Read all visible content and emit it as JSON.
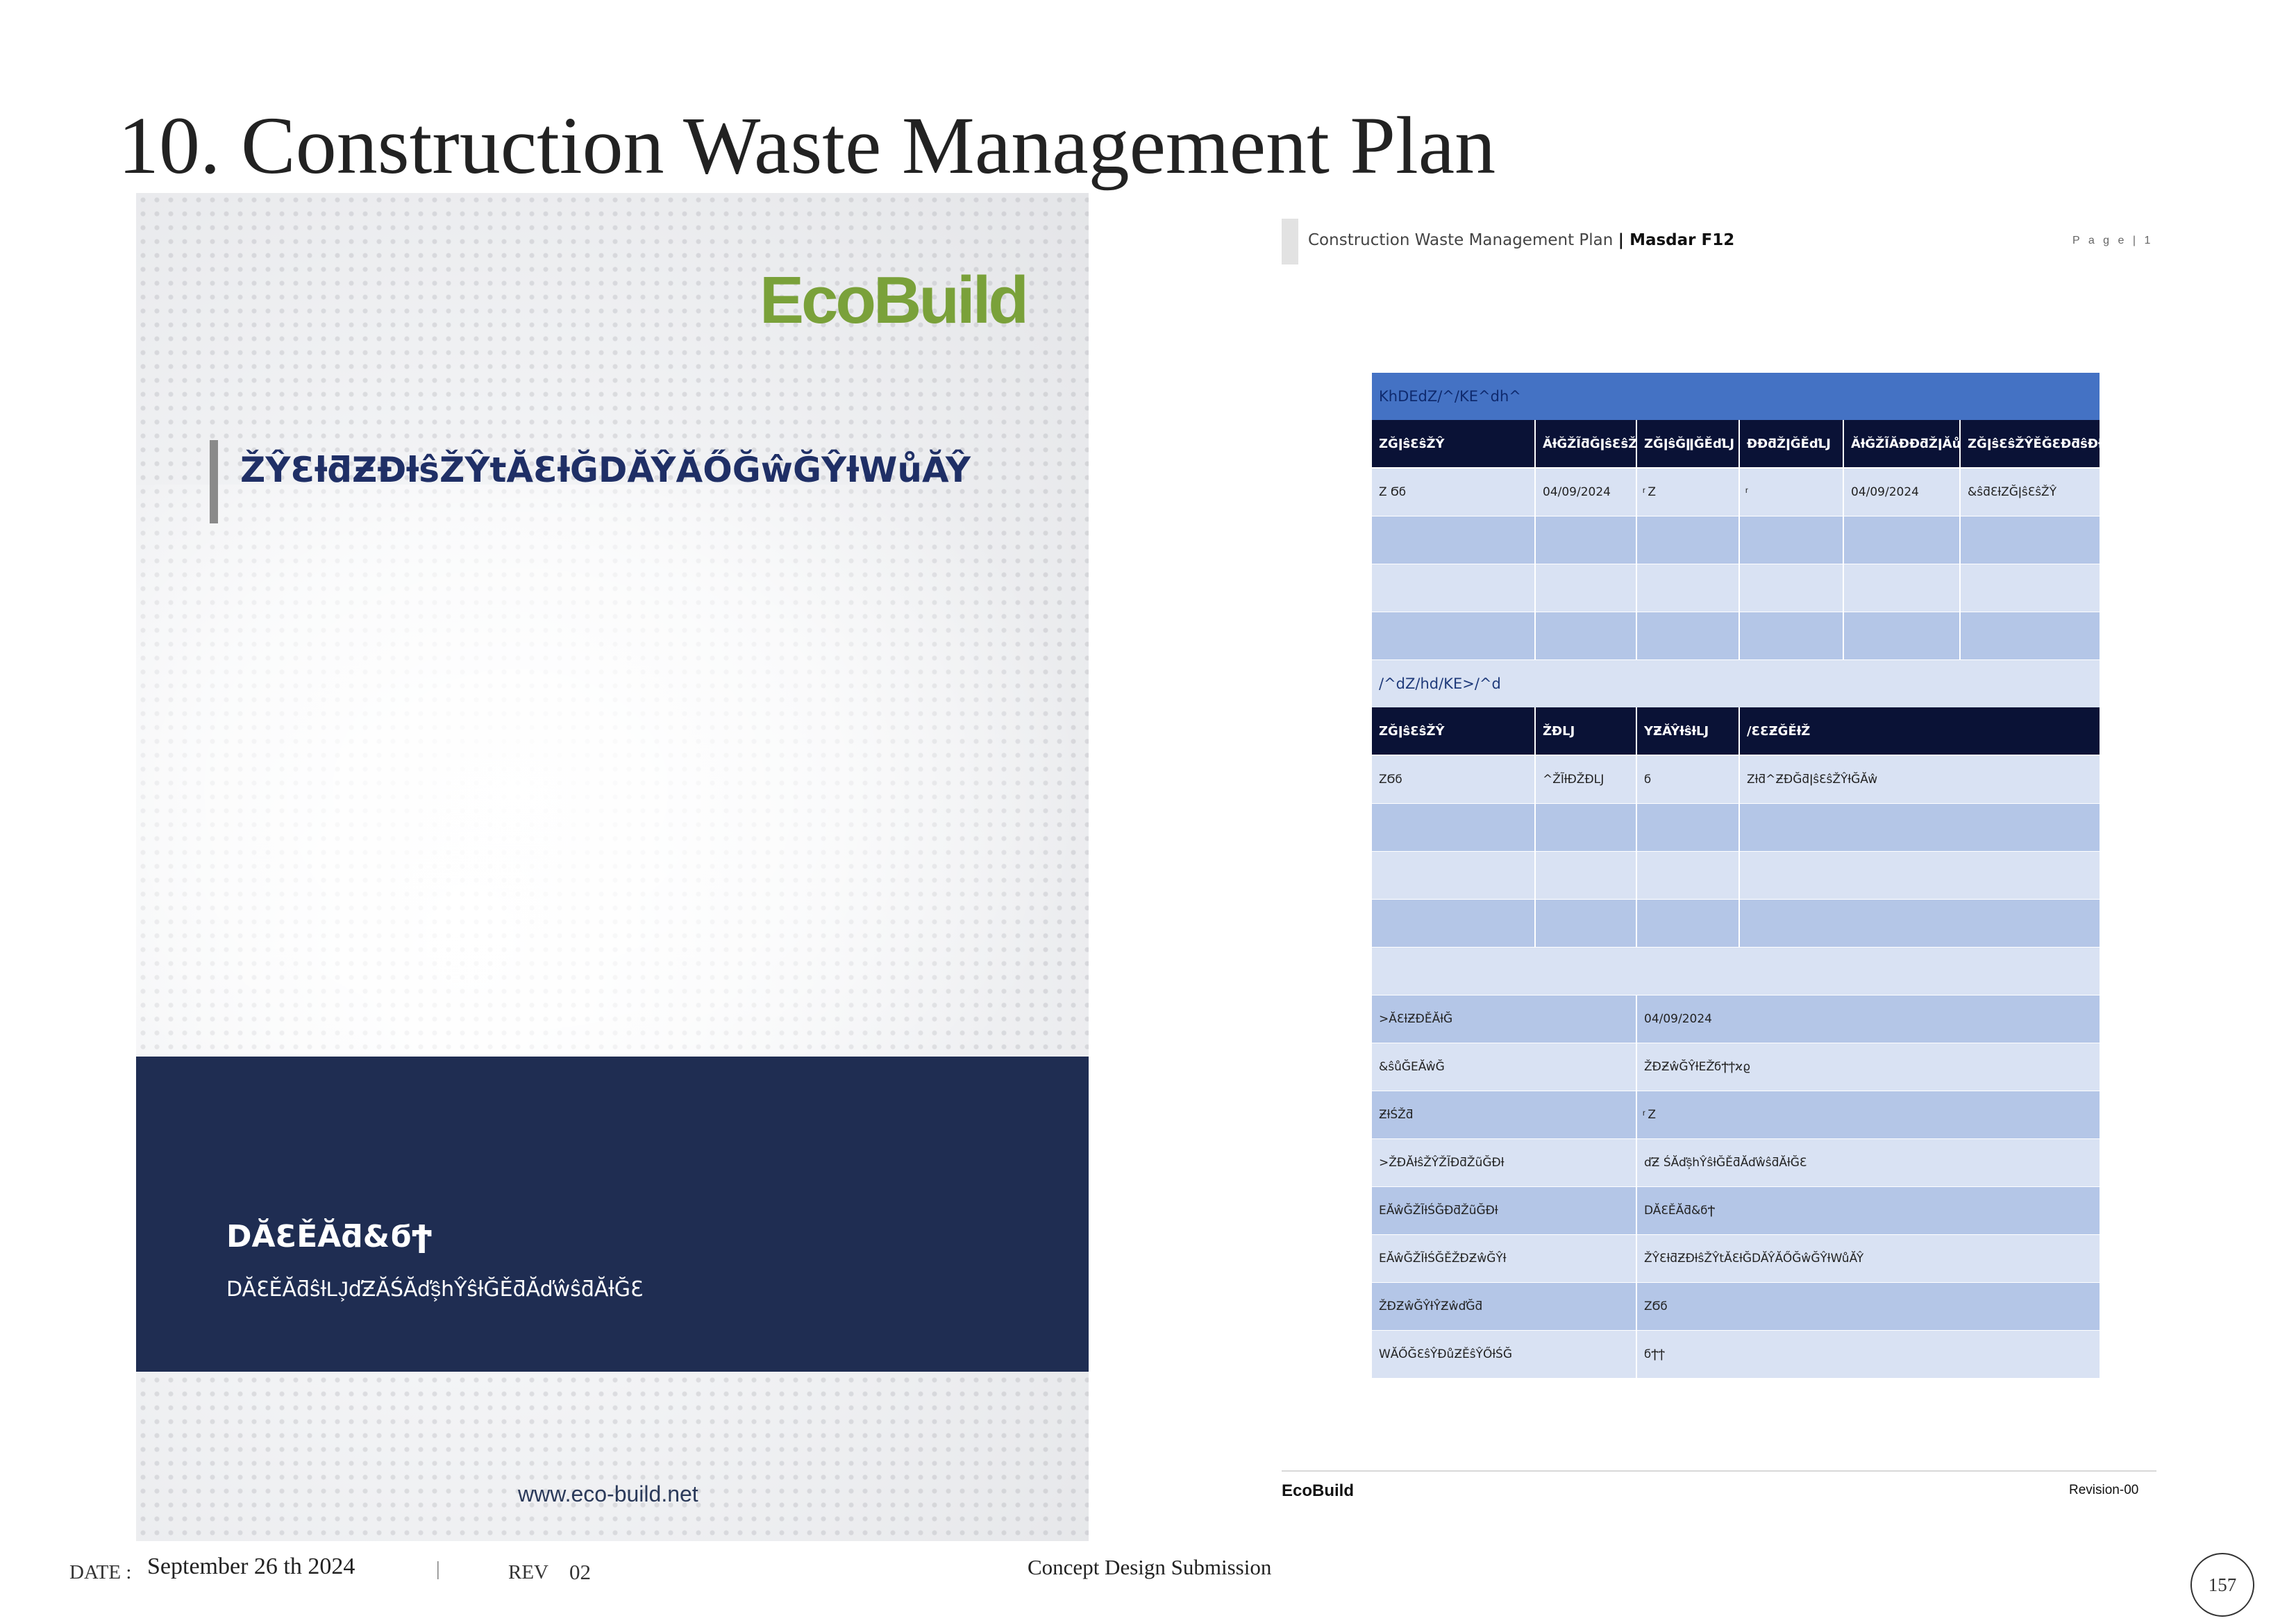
{
  "slide": {
    "title": "10. Construction Waste Management Plan",
    "footer": {
      "date_label": "DATE :",
      "date_value": "September 26 th 2024",
      "separator": "|",
      "rev_label": "REV",
      "rev_value": "02",
      "submission": "Concept Design Submission",
      "page_number": "157"
    }
  },
  "cover": {
    "logo": "EcoBuild",
    "glyph_a": "",
    "glyph_b": "",
    "title": "ŽŶƐƚƌƵĐƚŝŽŶtĂƐƚĞDĂŶĂŐĞŵĞŶƚWůĂŶ",
    "band_title": "DĂƐĚĂƌ&ϭϮ",
    "band_subtitle": "DĂƐĚĂƌŝƚǇ͕ďƵĂŚĂďŝ͕hŶŝƚĞĚƌĂďŵŝƌĂƚĞƐ",
    "url": "www.eco-build.net",
    "colors": {
      "logo": "#7aa13a",
      "band": "#1f2d52",
      "title": "#1f2f66"
    }
  },
  "document": {
    "header_text": "Construction Waste Management Plan ",
    "header_bold": "| Masdar F12",
    "page_label": "P a g e  | 1",
    "top_glyph": "",
    "table": {
      "section1_title": "KhDEdZ/^/KE^dh^",
      "section1_headers": [
        "ZĞǀŝƐŝŽŶ",
        "ĂƚĞŽĨƌĞǀŝƐŝŽŶ",
        "ZĞǀŝĞǁĞĚďǇ",
        "ƉƉƌŽǀĞĚďǇ",
        "ĂƚĞŽĨĂƉƉƌŽǀĂů",
        "ZĞǀŝƐŝŽŶĚĞƐĐƌŝƉƚŝŽŶ"
      ],
      "section1_rows": [
        [
          "Z Ϭϭ",
          "04/09/2024",
          "ͬ Z",
          "ͬ",
          "04/09/2024",
          "&ŝƌƐƚZĞǀŝƐŝŽŶ"
        ],
        [
          "",
          "",
          "",
          "",
          "",
          ""
        ],
        [
          "",
          "",
          "",
          "",
          "",
          ""
        ],
        [
          "",
          "",
          "",
          "",
          "",
          ""
        ]
      ],
      "section2_title": "/^dZ/hd/KE>/^d",
      "section2_headers": [
        "ZĞǀŝƐŝŽŶ",
        "ŽƉǇ",
        "YƵĂŶƚŝƚǇ",
        "/ƐƐƵĞĚƚŽ"
      ],
      "section2_rows": [
        [
          "ZϬϭ",
          "^ŽĨƚĐŽƉǇ",
          "ϭ",
          "Zƚƌ^ƵƉĞƌǀŝƐŝŽŶƚĞĂŵ"
        ],
        [
          "",
          "",
          "",
          ""
        ],
        [
          "",
          "",
          "",
          ""
        ],
        [
          "",
          "",
          "",
          ""
        ]
      ],
      "info_rows": [
        {
          "label": ">ĂƐƚƵƉĚĂƚĞ",
          "value": "04/09/2024"
        },
        {
          "label": "&ŝůĞEĂŵĞ",
          "value": "ŽĐƵŵĞŶƚEŽ͘ϭϮϯϰϱ"
        },
        {
          "label": "ƵƚŚŽƌ",
          "value": "ͬ Z"
        },
        {
          "label": ">ŽĐĂƚŝŽŶŽĨƉƌŽũĞĐƚ",
          "value": "ďƵ ŚĂďŝ͕hŶŝƚĞĚƌĂďŵŝƌĂƚĞƐ"
        },
        {
          "label": "EĂŵĞŽĨƚŚĞƉƌŽũĞĐƚ",
          "value": "DĂƐĚĂƌ&ϭϮ"
        },
        {
          "label": "EĂŵĞŽĨƚŚĞĚŽĐƵŵĞŶƚ",
          "value": "ŽŶƐƚƌƵĐƚŝŽŶtĂƐƚĞDĂŶĂŐĞŵĞŶƚWůĂŶ"
        },
        {
          "label": "ŽĐƵŵĞŶƚŶƵŵďĞƌ",
          "value": "ZϬϭ"
        },
        {
          "label": "WĂŐĞƐŝŶĐůƵĚŝŶŐƚŚĞ",
          "value": "ϭϮϯ"
        }
      ]
    },
    "footer_left": "EcoBuild",
    "footer_right": "Revision-00",
    "colors": {
      "table_title": "#4472c4",
      "table_header": "#0a1236",
      "row_light": "#d9e2f3",
      "row_dark": "#b4c6e7"
    }
  }
}
